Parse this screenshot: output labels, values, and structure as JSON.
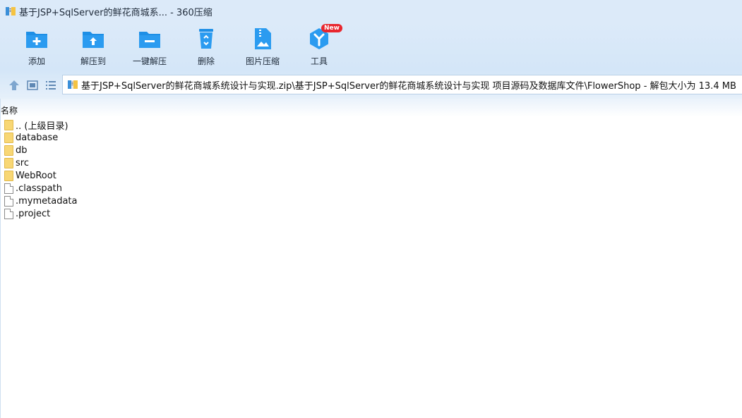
{
  "window": {
    "title": "基于JSP+SqlServer的鲜花商城系... - 360压缩"
  },
  "toolbar": {
    "items": [
      {
        "label": "添加",
        "icon": "add-folder-icon"
      },
      {
        "label": "解压到",
        "icon": "extract-to-icon"
      },
      {
        "label": "一键解压",
        "icon": "quick-extract-icon"
      },
      {
        "label": "删除",
        "icon": "recycle-bin-icon"
      },
      {
        "label": "图片压缩",
        "icon": "image-compress-icon"
      },
      {
        "label": "工具",
        "icon": "tools-icon",
        "badge": "New"
      }
    ]
  },
  "address": {
    "path": "基于JSP+SqlServer的鲜花商城系统设计与实现.zip\\基于JSP+SqlServer的鲜花商城系统设计与实现 项目源码及数据库文件\\FlowerShop - 解包大小为 13.4 MB"
  },
  "list": {
    "column_name": "名称",
    "items": [
      {
        "name": ".. (上级目录)",
        "type": "folder"
      },
      {
        "name": "database",
        "type": "folder"
      },
      {
        "name": "db",
        "type": "folder"
      },
      {
        "name": "src",
        "type": "folder"
      },
      {
        "name": "WebRoot",
        "type": "folder"
      },
      {
        "name": ".classpath",
        "type": "file"
      },
      {
        "name": ".mymetadata",
        "type": "file"
      },
      {
        "name": ".project",
        "type": "file"
      }
    ]
  },
  "colors": {
    "accent": "#1e8fe6",
    "titlebar_bg": "#dceaf9",
    "badge": "#e8262e"
  }
}
